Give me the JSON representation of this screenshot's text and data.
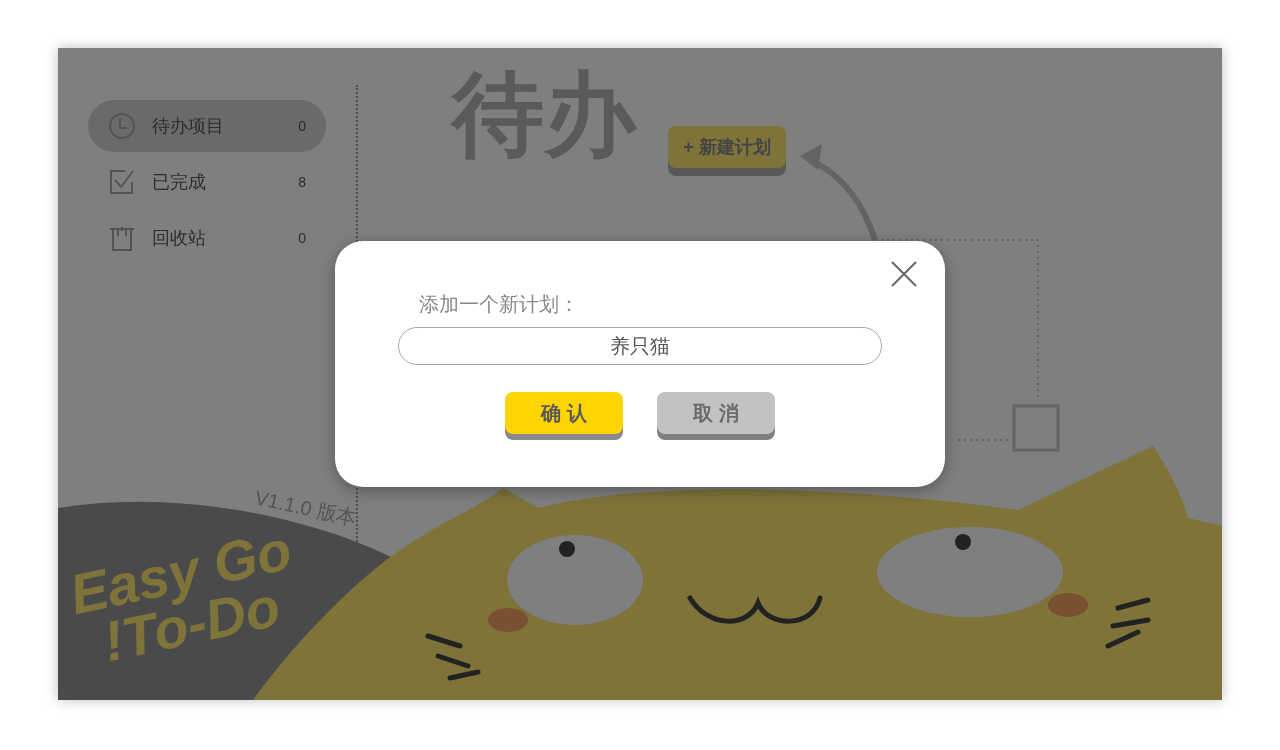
{
  "sidebar": {
    "items": [
      {
        "kind": "clock",
        "label": "待办项目",
        "count": "0",
        "selected": true
      },
      {
        "kind": "check",
        "label": "已完成",
        "count": "8",
        "selected": false
      },
      {
        "kind": "trash",
        "label": "回收站",
        "count": "0",
        "selected": false
      }
    ]
  },
  "version": "V1.1.0 版本",
  "logo": {
    "lines": [
      "Easy Go",
      "To-Do"
    ],
    "mark": "!"
  },
  "main": {
    "title": "待办",
    "new_button": "+ 新建计划"
  },
  "dialog": {
    "label": "添加一个新计划：",
    "value": "养只猫",
    "buttons": [
      {
        "kind": "primary",
        "label": "确 认"
      },
      {
        "kind": "secondary",
        "label": "取 消"
      }
    ]
  }
}
